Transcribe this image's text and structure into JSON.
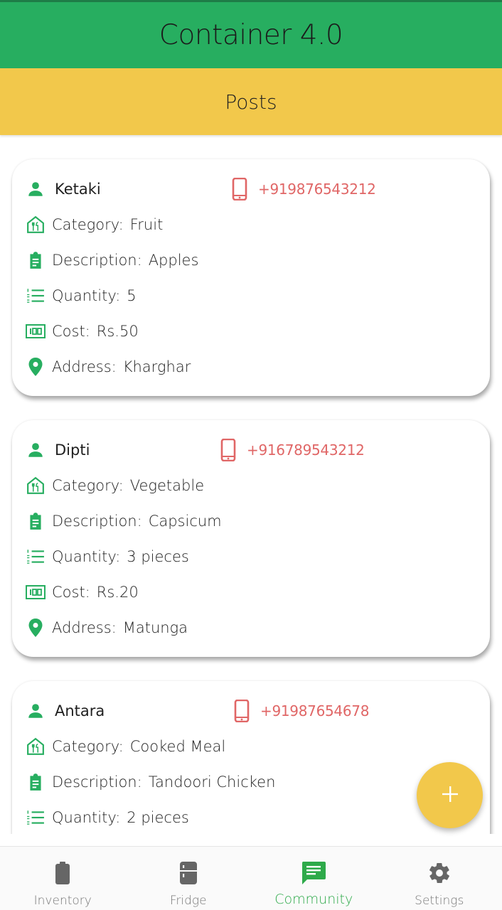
{
  "app": {
    "title": "Container 4.0"
  },
  "page": {
    "title": "Posts"
  },
  "colors": {
    "primary": "#27ae60",
    "accent": "#f2c84b",
    "phone": "#e06666",
    "icon": "#27ae60"
  },
  "posts": [
    {
      "name": "Ketaki",
      "phone": "+919876543212",
      "category_label": "Category:",
      "category": "Fruit",
      "description_label": "Description:",
      "description": "Apples",
      "quantity_label": "Quantity:",
      "quantity": "5",
      "cost_label": "Cost:",
      "cost": "Rs.50",
      "address_label": "Address:",
      "address": "Kharghar"
    },
    {
      "name": "Dipti",
      "phone": "+916789543212",
      "category_label": "Category:",
      "category": "Vegetable",
      "description_label": "Description:",
      "description": "Capsicum",
      "quantity_label": "Quantity:",
      "quantity": "3 pieces",
      "cost_label": "Cost:",
      "cost": "Rs.20",
      "address_label": "Address:",
      "address": "Matunga"
    },
    {
      "name": "Antara",
      "phone": "+91987654678",
      "category_label": "Category:",
      "category": "Cooked Meal",
      "description_label": "Description:",
      "description": "Tandoori Chicken",
      "quantity_label": "Quantity:",
      "quantity": "2 pieces"
    }
  ],
  "fab": {
    "icon": "plus-icon"
  },
  "nav": {
    "items": [
      {
        "label": "Inventory",
        "icon": "battery-icon"
      },
      {
        "label": "Fridge",
        "icon": "fridge-icon"
      },
      {
        "label": "Community",
        "icon": "chat-icon",
        "active": true
      },
      {
        "label": "Settings",
        "icon": "gear-icon"
      }
    ]
  }
}
